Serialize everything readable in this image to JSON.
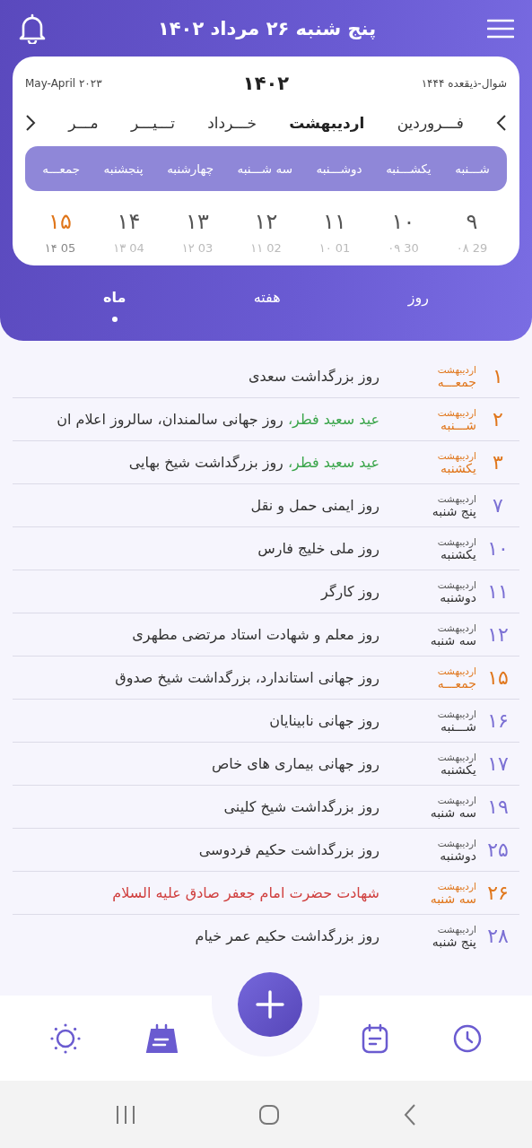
{
  "app_bar": {
    "title": "پنج شنبه ۲۶ مرداد ۱۴۰۲"
  },
  "calendar": {
    "hijri_range": "شوال-ذیقعده ۱۴۴۴",
    "year": "۱۴۰۲",
    "gregorian_range": "May-April ۲۰۲۳",
    "months": [
      {
        "label": "فـــروردین",
        "selected": false
      },
      {
        "label": "اردیبهشت",
        "selected": true
      },
      {
        "label": "خـــرداد",
        "selected": false
      },
      {
        "label": "تـــیـــر",
        "selected": false
      },
      {
        "label": "مـــر",
        "selected": false
      }
    ],
    "weekdays": [
      "شـــنبه",
      "یکشـــنبه",
      "دوشـــنبه",
      "سه شـــنبه",
      "چهارشنبه",
      "پنجشنبه",
      "جمعـــه"
    ],
    "days": [
      {
        "day": "۹",
        "sub": "۰۸ 29",
        "holiday": false
      },
      {
        "day": "۱۰",
        "sub": "۰۹ 30",
        "holiday": false
      },
      {
        "day": "۱۱",
        "sub": "۱۰ 01",
        "holiday": false
      },
      {
        "day": "۱۲",
        "sub": "۱۱ 02",
        "holiday": false
      },
      {
        "day": "۱۳",
        "sub": "۱۲ 03",
        "holiday": false
      },
      {
        "day": "۱۴",
        "sub": "۱۳ 04",
        "holiday": false
      },
      {
        "day": "۱۵",
        "sub": "۱۴ 05",
        "holiday": true
      }
    ]
  },
  "view_tabs": [
    {
      "label": "روز",
      "selected": false
    },
    {
      "label": "هفته",
      "selected": false
    },
    {
      "label": "ماه",
      "selected": true
    }
  ],
  "events": [
    {
      "day": "۱",
      "month": "اردیبهشت",
      "weekday": "جمعـــه",
      "holiday": true,
      "parts": [
        {
          "text": "روز بزرگداشت سعدی",
          "kind": "normal"
        }
      ]
    },
    {
      "day": "۲",
      "month": "اردیبهشت",
      "weekday": "شـــنبه",
      "holiday": true,
      "parts": [
        {
          "text": "عید سعید فطر،",
          "kind": "eid"
        },
        {
          "text": " روز جهانی سالمندان، سالروز اعلام ان",
          "kind": "normal"
        }
      ]
    },
    {
      "day": "۳",
      "month": "اردیبهشت",
      "weekday": "یکشنبه",
      "holiday": true,
      "parts": [
        {
          "text": "عید سعید فطر،",
          "kind": "eid"
        },
        {
          "text": " روز بزرگداشت شیخ بهایی",
          "kind": "normal"
        }
      ]
    },
    {
      "day": "۷",
      "month": "اردیبهشت",
      "weekday": "پنج شنبه",
      "holiday": false,
      "parts": [
        {
          "text": "روز ایمنی حمل و نقل",
          "kind": "normal"
        }
      ]
    },
    {
      "day": "۱۰",
      "month": "اردیبهشت",
      "weekday": "یکشنبه",
      "holiday": false,
      "parts": [
        {
          "text": "روز ملی خلیج فارس",
          "kind": "normal"
        }
      ]
    },
    {
      "day": "۱۱",
      "month": "اردیبهشت",
      "weekday": "دوشنبه",
      "holiday": false,
      "parts": [
        {
          "text": "روز کارگر",
          "kind": "normal"
        }
      ]
    },
    {
      "day": "۱۲",
      "month": "اردیبهشت",
      "weekday": "سه شنبه",
      "holiday": false,
      "parts": [
        {
          "text": "روز معلم و شهادت استاد مرتضی مطهری",
          "kind": "normal"
        }
      ]
    },
    {
      "day": "۱۵",
      "month": "اردیبهشت",
      "weekday": "جمعـــه",
      "holiday": true,
      "parts": [
        {
          "text": "روز جهانی استاندارد، بزرگداشت شیخ صدوق",
          "kind": "normal"
        }
      ]
    },
    {
      "day": "۱۶",
      "month": "اردیبهشت",
      "weekday": "شـــنبه",
      "holiday": false,
      "parts": [
        {
          "text": "روز جهانی نابینایان",
          "kind": "normal"
        }
      ]
    },
    {
      "day": "۱۷",
      "month": "اردیبهشت",
      "weekday": "یکشنبه",
      "holiday": false,
      "parts": [
        {
          "text": "روز جهانی بیماری های خاص",
          "kind": "normal"
        }
      ]
    },
    {
      "day": "۱۹",
      "month": "اردیبهشت",
      "weekday": "سه شنبه",
      "holiday": false,
      "parts": [
        {
          "text": "روز بزرگداشت شیخ کلینی",
          "kind": "normal"
        }
      ]
    },
    {
      "day": "۲۵",
      "month": "اردیبهشت",
      "weekday": "دوشنبه",
      "holiday": false,
      "parts": [
        {
          "text": "روز بزرگداشت حکیم فردوسی",
          "kind": "normal"
        }
      ]
    },
    {
      "day": "۲۶",
      "month": "اردیبهشت",
      "weekday": "سه شنبه",
      "holiday": true,
      "parts": [
        {
          "text": "شهادت حضرت امام جعفر صادق علیه السلام",
          "kind": "mourning"
        }
      ]
    },
    {
      "day": "۲۸",
      "month": "اردیبهشت",
      "weekday": "پنج شنبه",
      "holiday": false,
      "parts": [
        {
          "text": "روز بزرگداشت حکیم عمر خیام",
          "kind": "normal"
        }
      ]
    }
  ],
  "bottom_nav": [
    {
      "kind": "clock",
      "selected": false
    },
    {
      "kind": "notes",
      "selected": false
    },
    {
      "kind": "add"
    },
    {
      "kind": "calendar",
      "selected": true
    },
    {
      "kind": "sun",
      "selected": false
    }
  ]
}
